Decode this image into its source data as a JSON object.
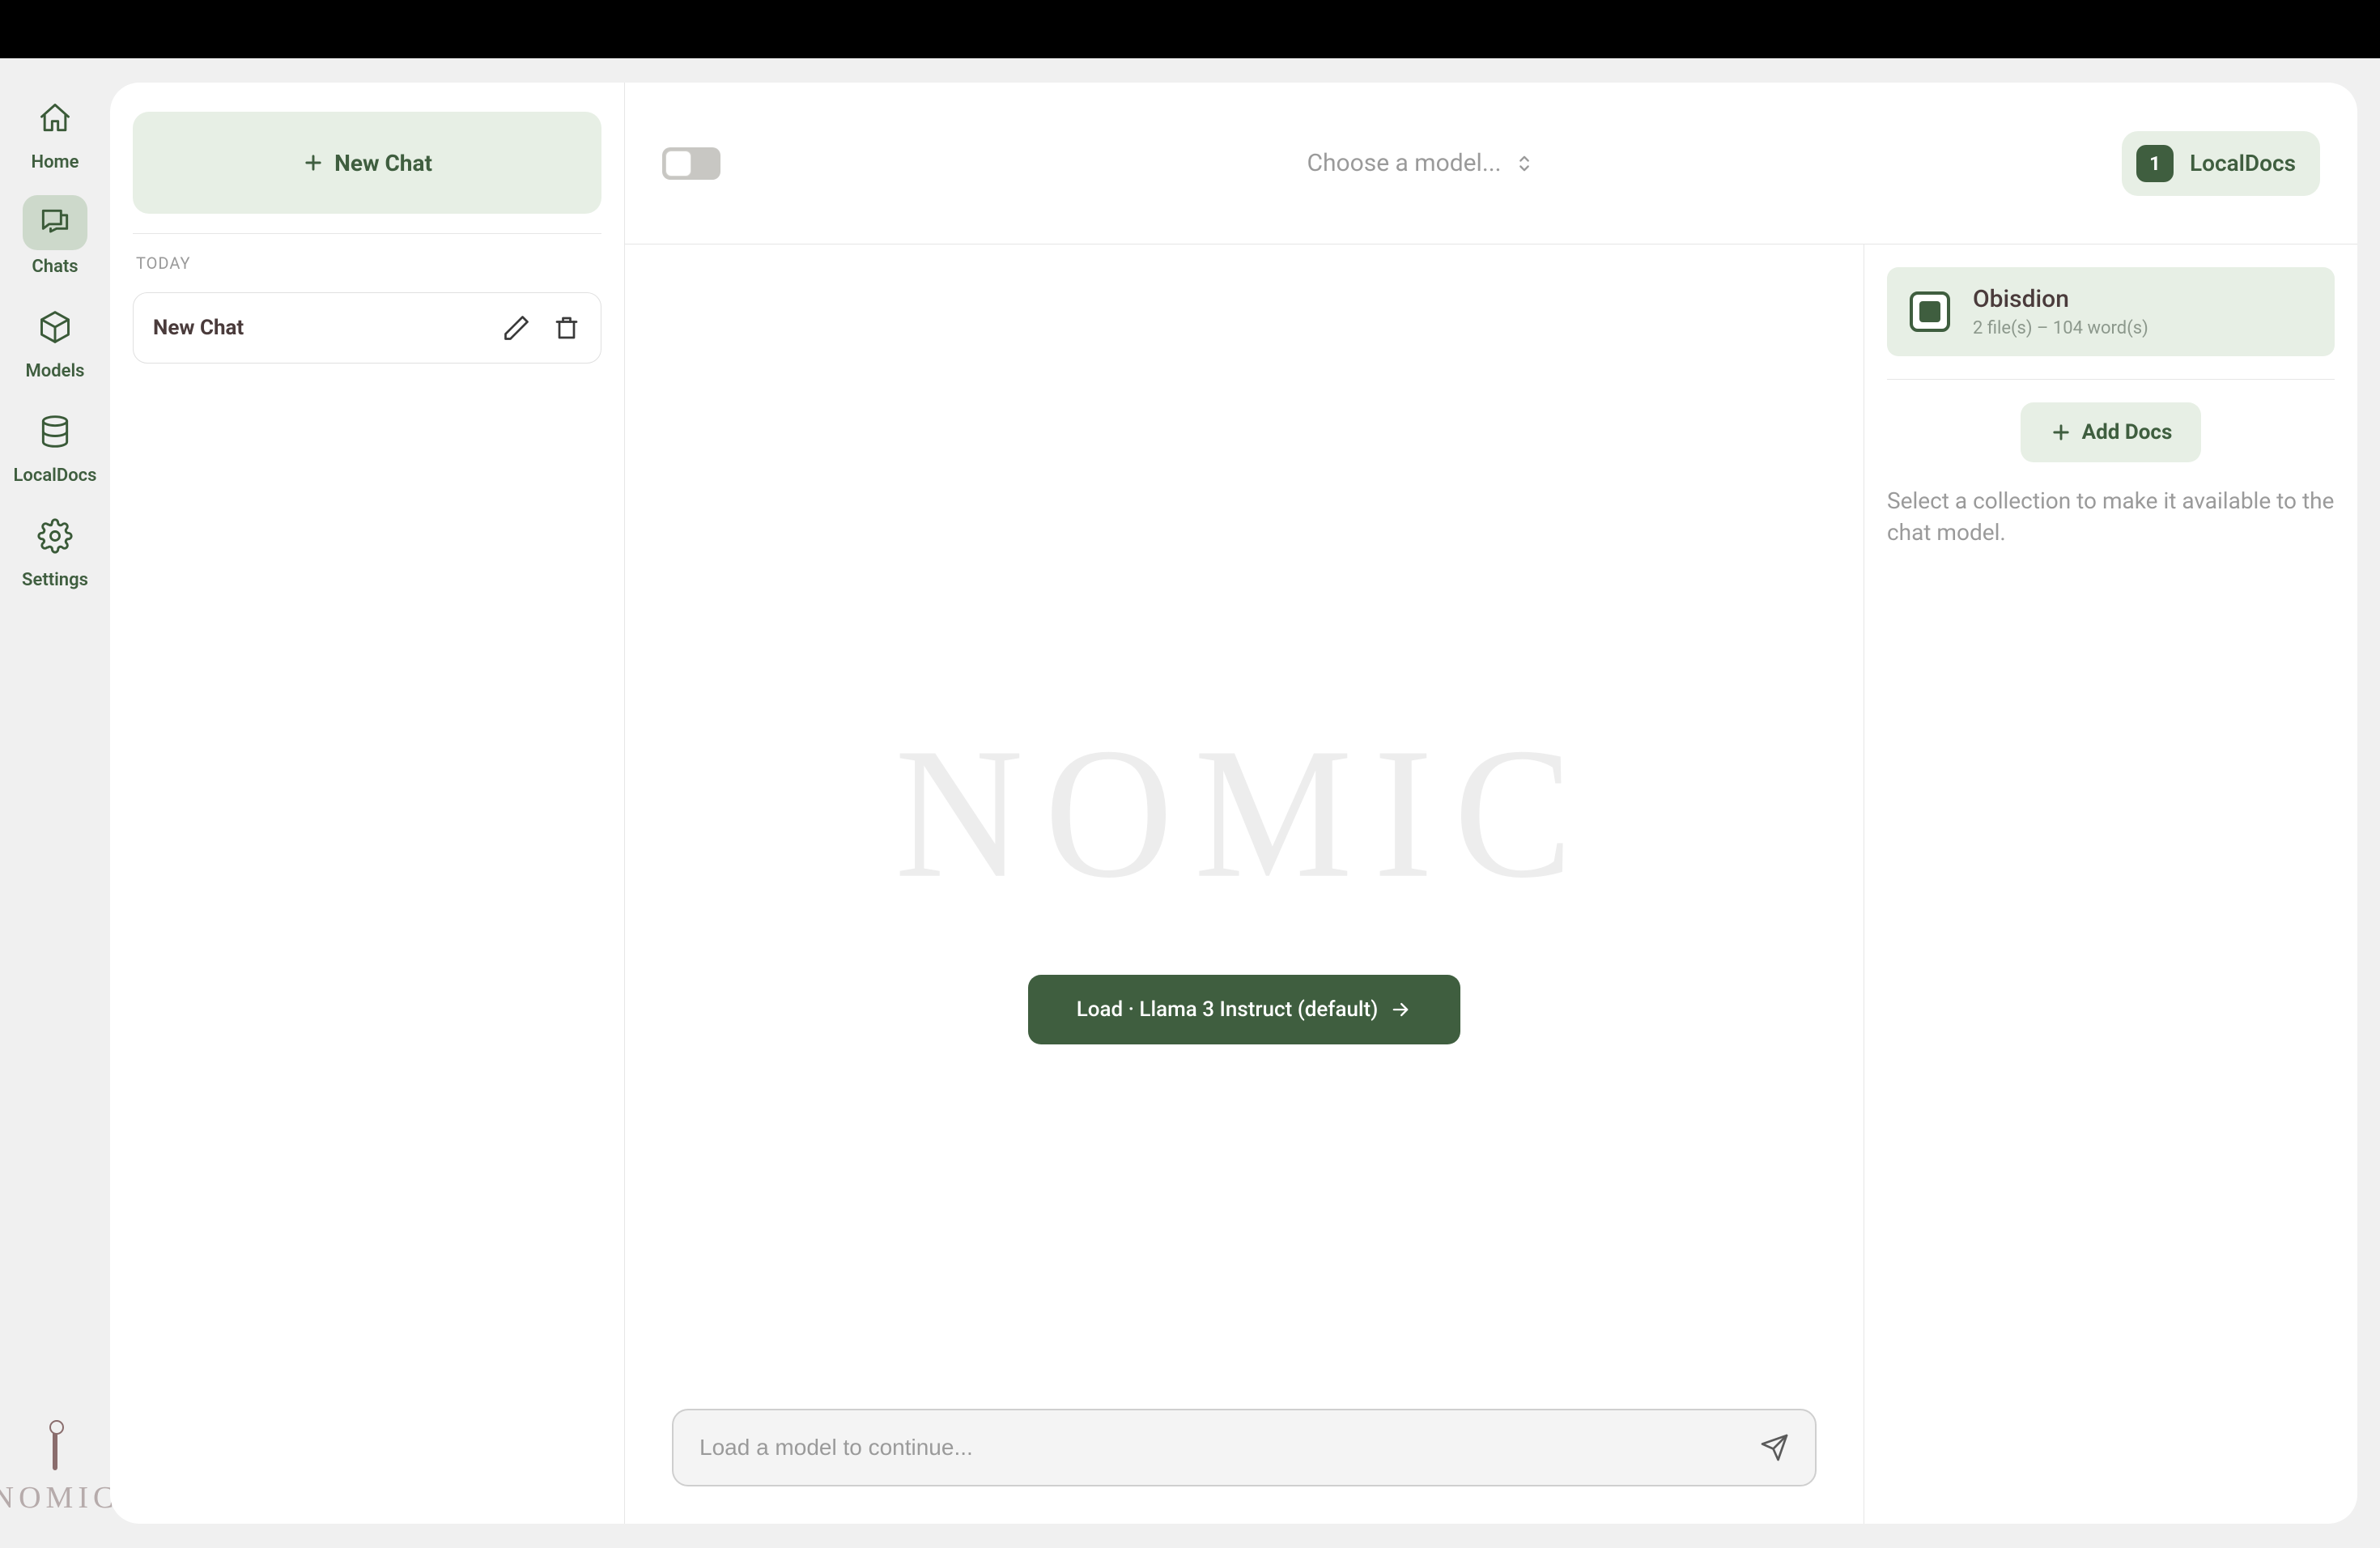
{
  "nav": {
    "items": [
      {
        "id": "home",
        "label": "Home"
      },
      {
        "id": "chats",
        "label": "Chats"
      },
      {
        "id": "models",
        "label": "Models"
      },
      {
        "id": "localdocs",
        "label": "LocalDocs"
      },
      {
        "id": "settings",
        "label": "Settings"
      }
    ],
    "active": "chats",
    "brand": "NOMIC"
  },
  "chatList": {
    "newChatLabel": "New Chat",
    "sectionLabel": "TODAY",
    "chats": [
      {
        "title": "New Chat"
      }
    ]
  },
  "header": {
    "modelPickerPlaceholder": "Choose a model...",
    "localDocs": {
      "count": "1",
      "label": "LocalDocs"
    }
  },
  "center": {
    "watermark": "NOMIC",
    "loadButton": "Load · Llama 3 Instruct (default)",
    "composerPlaceholder": "Load a model to continue..."
  },
  "docs": {
    "collections": [
      {
        "name": "Obisdion",
        "sub": "2 file(s) – 104 word(s)",
        "checked": true
      }
    ],
    "addDocsLabel": "Add Docs",
    "hint": "Select a collection to make it available to the chat model."
  }
}
